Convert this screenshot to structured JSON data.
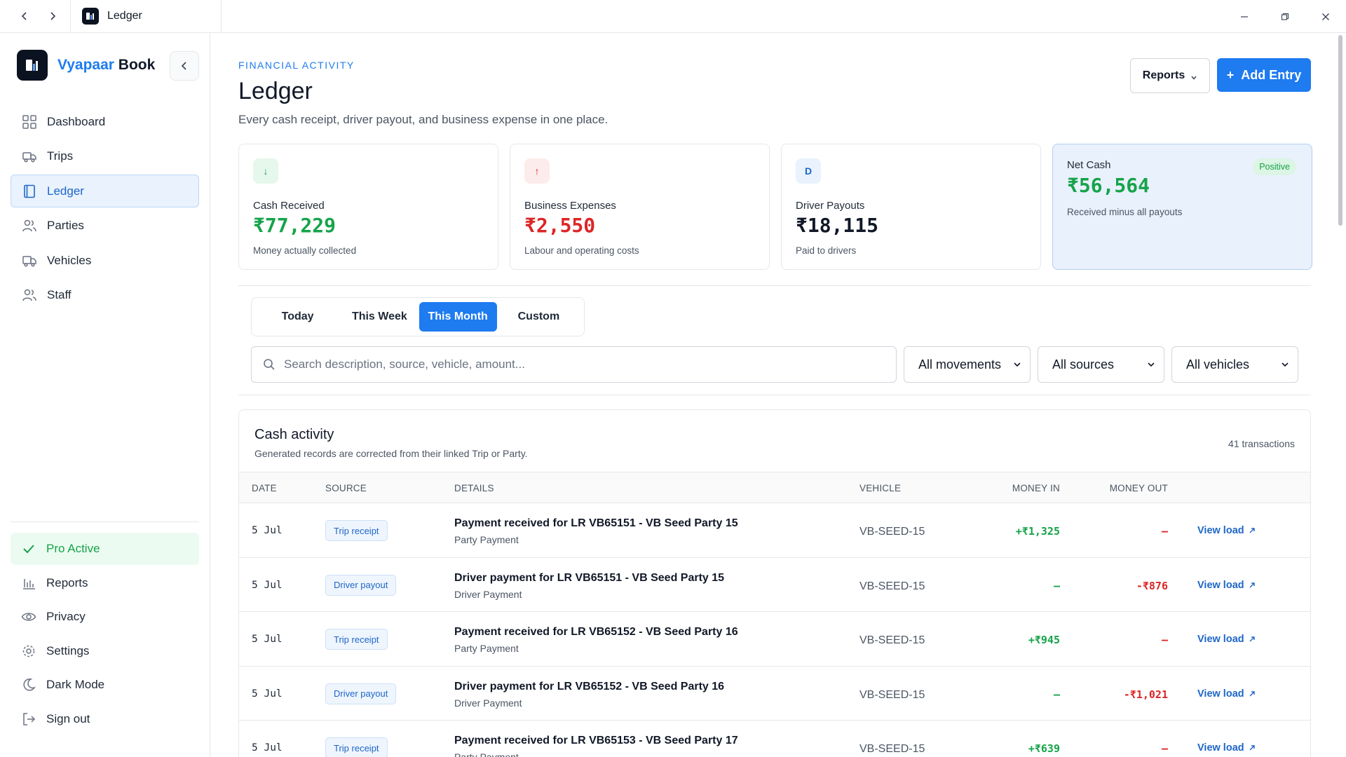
{
  "titlebar": {
    "tab_title": "Ledger"
  },
  "brand": {
    "name_accent": "Vyapaar",
    "name_rest": " Book"
  },
  "sidebar": {
    "items": [
      {
        "label": "Dashboard"
      },
      {
        "label": "Trips"
      },
      {
        "label": "Ledger"
      },
      {
        "label": "Parties"
      },
      {
        "label": "Vehicles"
      },
      {
        "label": "Staff"
      }
    ],
    "bottom": [
      {
        "label": "Pro Active"
      },
      {
        "label": "Reports"
      },
      {
        "label": "Privacy"
      },
      {
        "label": "Settings"
      },
      {
        "label": "Dark Mode"
      },
      {
        "label": "Sign out"
      }
    ]
  },
  "header": {
    "eyebrow": "FINANCIAL ACTIVITY",
    "title": "Ledger",
    "subtitle": "Every cash receipt, driver payout, and business expense in one place.",
    "reports_label": "Reports",
    "add_label": "Add Entry"
  },
  "cards": [
    {
      "icon_text": "↓",
      "label": "Cash Received",
      "value": "₹77,229",
      "note": "Money actually collected",
      "color": "#16a34a"
    },
    {
      "icon_text": "↑",
      "label": "Business Expenses",
      "value": "₹2,550",
      "note": "Labour and operating costs",
      "color": "#dc2626"
    },
    {
      "icon_text": "D",
      "label": "Driver Payouts",
      "value": "₹18,115",
      "note": "Paid to drivers",
      "color": "#111827"
    },
    {
      "label": "Net Cash",
      "value": "₹56,564",
      "note": "Received minus all payouts",
      "badge": "Positive",
      "color": "#16a34a"
    }
  ],
  "periods": [
    "Today",
    "This Week",
    "This Month",
    "Custom"
  ],
  "active_period": "This Month",
  "search": {
    "placeholder": "Search description, source, vehicle, amount..."
  },
  "filters": {
    "movements": "All movements",
    "sources": "All sources",
    "vehicles": "All vehicles"
  },
  "activity": {
    "title": "Cash activity",
    "subtitle": "Generated records are corrected from their linked Trip or Party.",
    "count": "41 transactions",
    "columns": {
      "date": "DATE",
      "source": "SOURCE",
      "details": "DETAILS",
      "vehicle": "VEHICLE",
      "money_in": "MONEY IN",
      "money_out": "MONEY OUT"
    },
    "rows": [
      {
        "date": "5 Jul",
        "source": "Trip receipt",
        "title": "Payment received for LR VB65151 - VB Seed Party 15",
        "sub": "Party Payment",
        "vehicle": "VB-SEED-15",
        "money_in": "+₹1,325",
        "money_out": "–",
        "action": "View load"
      },
      {
        "date": "5 Jul",
        "source": "Driver payout",
        "title": "Driver payment for LR VB65151 - VB Seed Party 15",
        "sub": "Driver Payment",
        "vehicle": "VB-SEED-15",
        "money_in": "–",
        "money_out": "-₹876",
        "action": "View load"
      },
      {
        "date": "5 Jul",
        "source": "Trip receipt",
        "title": "Payment received for LR VB65152 - VB Seed Party 16",
        "sub": "Party Payment",
        "vehicle": "VB-SEED-15",
        "money_in": "+₹945",
        "money_out": "–",
        "action": "View load"
      },
      {
        "date": "5 Jul",
        "source": "Driver payout",
        "title": "Driver payment for LR VB65152 - VB Seed Party 16",
        "sub": "Driver Payment",
        "vehicle": "VB-SEED-15",
        "money_in": "–",
        "money_out": "-₹1,021",
        "action": "View load"
      },
      {
        "date": "5 Jul",
        "source": "Trip receipt",
        "title": "Payment received for LR VB65153 - VB Seed Party 17",
        "sub": "Party Payment",
        "vehicle": "VB-SEED-15",
        "money_in": "+₹639",
        "money_out": "–",
        "action": "View load"
      }
    ]
  }
}
